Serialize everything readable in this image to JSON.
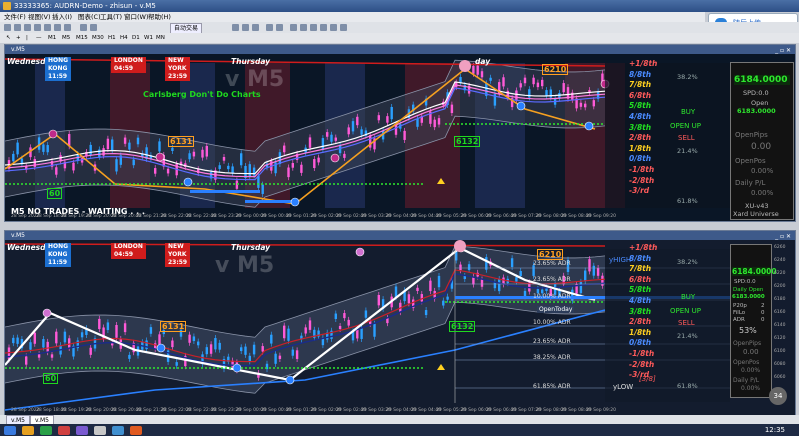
{
  "window_title": "33333365: AUDRN-Demo - zhisun - v.M5",
  "cloud_button": "随后上传",
  "menu": [
    "文件(F)",
    "视图(V)",
    "插入(I)",
    "图表(C)",
    "工具(T)",
    "窗口(W)",
    "帮助(H)"
  ],
  "autotrade_label": "自动交易",
  "timeframes": [
    "M1",
    "M5",
    "M15",
    "M30",
    "H1",
    "H4",
    "D1",
    "W1",
    "MN"
  ],
  "top_chart": {
    "tab_title": "v.M5",
    "day_left": "Wednesday",
    "day_right": "Thursday",
    "day_far": "day",
    "sessions": [
      {
        "label": "HONG KONG 11:59",
        "color": "#1c6fd0"
      },
      {
        "label": "LONDON 04:59",
        "color": "#d01c1c"
      },
      {
        "label": "NEW YORK 23:59",
        "color": "#d01c1c"
      }
    ],
    "watermark": "v M5",
    "promo": "Carlsberg Don't Do Charts",
    "status": "M5  NO TRADES - WAITING . . .",
    "levels": [
      {
        "text": "+1/8th",
        "color": "#ff5a5a"
      },
      {
        "text": "8/8th",
        "color": "#4a8bff"
      },
      {
        "text": "7/8th",
        "color": "#ffd020"
      },
      {
        "text": "6/8th",
        "color": "#ff5a5a"
      },
      {
        "text": "5/8th",
        "color": "#22e022"
      },
      {
        "text": "4/8th",
        "color": "#4a8bff"
      },
      {
        "text": "3/8th",
        "color": "#22e022"
      },
      {
        "text": "2/8th",
        "color": "#ff5a5a"
      },
      {
        "text": "1/8th",
        "color": "#ffd020"
      },
      {
        "text": "0/8th",
        "color": "#4a8bff"
      },
      {
        "text": "-1/8th",
        "color": "#ff5a5a"
      },
      {
        "text": "-2/8th",
        "color": "#ff5a5a"
      },
      {
        "text": "-3/rd",
        "color": "#ff5a5a"
      }
    ],
    "pcts": [
      "38.2%",
      "21.4%",
      "61.8%"
    ],
    "signals": {
      "buy": "BUY",
      "open_up": "OPEN UP",
      "sell": "SELL"
    },
    "chips": [
      "6210",
      "6131",
      "6132",
      "60"
    ],
    "panel": {
      "price": "6184.0000",
      "spd": "SPD:0.0",
      "open_label": "Open",
      "open_price": "6183.0000",
      "open_pips_label": "OpenPips",
      "open_pips": "0.00",
      "open_pos_label": "OpenPos",
      "open_pos": "0.00%",
      "daily_pl_label": "Daily P/L",
      "daily_pl": "0.00%",
      "version": "XU-v43",
      "brand": "Xard Universe"
    },
    "x_ticks": [
      "28 Sep 2022",
      "28 Sep 18:40",
      "28 Sep 19:20",
      "28 Sep 20:00",
      "28 Sep 20:40",
      "28 Sep 21:20",
      "28 Sep 22:00",
      "28 Sep 22:40",
      "28 Sep 23:20",
      "29 Sep 00:00",
      "29 Sep 00:40",
      "29 Sep 01:20",
      "29 Sep 02:00",
      "29 Sep 02:40",
      "29 Sep 03:20",
      "29 Sep 04:00",
      "29 Sep 04:40",
      "29 Sep 05:20",
      "29 Sep 06:00",
      "29 Sep 06:40",
      "29 Sep 07:20",
      "29 Sep 08:00",
      "29 Sep 08:40",
      "29 Sep 09:20"
    ]
  },
  "bottom_chart": {
    "tab_title": "v.M5",
    "day_left": "Wednesday",
    "day_right": "Thursday",
    "sessions": [
      {
        "label": "HONG KONG 11:59",
        "color": "#1c6fd0"
      },
      {
        "label": "LONDON 04:59",
        "color": "#d01c1c"
      },
      {
        "label": "NEW YORK 23:59",
        "color": "#d01c1c"
      }
    ],
    "watermark": "v M5",
    "adr": [
      "23.65% ADR",
      "23.65% ADR",
      "10.00% ADR",
      "10.00% ADR",
      "23.65% ADR",
      "38.25% ADR",
      "61.85% ADR"
    ],
    "open_today": "OpenToday",
    "yhigh": "yHIGH",
    "ylow": "yLOW",
    "ylow_lvl": "[3/8]",
    "levels": [
      {
        "text": "+1/8th",
        "color": "#ff5a5a"
      },
      {
        "text": "8/8th",
        "color": "#4a8bff"
      },
      {
        "text": "7/8th",
        "color": "#ffd020"
      },
      {
        "text": "6/8th",
        "color": "#ff5a5a"
      },
      {
        "text": "5/8th",
        "color": "#22e022"
      },
      {
        "text": "4/8th",
        "color": "#4a8bff"
      },
      {
        "text": "3/8th",
        "color": "#22e022"
      },
      {
        "text": "2/8th",
        "color": "#ff5a5a"
      },
      {
        "text": "1/8th",
        "color": "#ffd020"
      },
      {
        "text": "0/8th",
        "color": "#4a8bff"
      },
      {
        "text": "-1/8th",
        "color": "#ff5a5a"
      },
      {
        "text": "-2/8th",
        "color": "#ff5a5a"
      },
      {
        "text": "-3/rd",
        "color": "#ff5a5a"
      }
    ],
    "pcts": [
      "38.2%",
      "21.4%",
      "61.8%"
    ],
    "signals": {
      "buy": "BUY",
      "open_up": "OPEN UP",
      "sell": "SELL"
    },
    "chips": [
      "6210",
      "6131",
      "6132",
      "60"
    ],
    "panel": {
      "price": "6184.0000",
      "spd": "SPD:0.0",
      "daily_open_label": "Daily Open",
      "daily_open": "6183.0000",
      "p20p": "P20p",
      "fillo": "FilLo",
      "adr": "ADR",
      "p20p_val": "2",
      "fillo_val": "0",
      "adr_val": "0",
      "pct": "53%",
      "open_pips_label": "OpenPips",
      "open_pips": "0.00",
      "open_pos_label": "OpenPos",
      "open_pos": "0.00%",
      "daily_pl_label": "Daily P/L",
      "daily_pl": "0.00%",
      "badge": "34"
    },
    "x_ticks": [
      "28 Sep 2022",
      "28 Sep 18:40",
      "28 Sep 19:20",
      "28 Sep 20:00",
      "28 Sep 20:40",
      "28 Sep 21:20",
      "28 Sep 22:00",
      "28 Sep 22:40",
      "28 Sep 23:20",
      "29 Sep 00:00",
      "29 Sep 00:40",
      "29 Sep 01:20",
      "29 Sep 02:00",
      "29 Sep 02:40",
      "29 Sep 03:20",
      "29 Sep 04:00",
      "29 Sep 04:40",
      "29 Sep 05:20",
      "29 Sep 06:00",
      "29 Sep 06:40",
      "29 Sep 07:20",
      "29 Sep 08:00",
      "29 Sep 08:40",
      "29 Sep 09:20"
    ],
    "y_ticks": [
      "6260",
      "6240",
      "6220",
      "6200",
      "6180",
      "6160",
      "6140",
      "6120",
      "6100",
      "6080",
      "6060"
    ]
  },
  "bottom_tabs": [
    "v.M5",
    "v.M5"
  ],
  "clock": "12:35"
}
